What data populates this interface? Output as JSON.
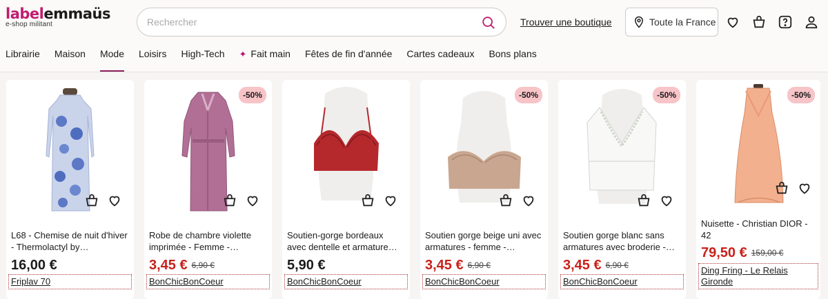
{
  "logo": {
    "part1": "label",
    "part2": "emmaüs",
    "tagline": "e-shop militant"
  },
  "search": {
    "placeholder": "Rechercher"
  },
  "header": {
    "find_store": "Trouver une boutique",
    "location": "Toute la France"
  },
  "nav": [
    "Librairie",
    "Maison",
    "Mode",
    "Loisirs",
    "High-Tech",
    "Fait main",
    "Fêtes de fin d'année",
    "Cartes cadeaux",
    "Bons plans"
  ],
  "nav_active": "Mode",
  "colors": {
    "brand": "#c01d6f",
    "sale_price": "#c8211b",
    "discount_badge": "#f7c4c8",
    "nav_active": "#8b1f5c"
  },
  "products": [
    {
      "title": "L68 - Chemise de nuit d'hiver - Thermolactyl by…",
      "price": "16,00 €",
      "old_price": "",
      "discount": "",
      "seller": "Friplav 70"
    },
    {
      "title": "Robe de chambre violette imprimée - Femme -…",
      "price": "3,45 €",
      "old_price": "6,90 €",
      "discount": "-50%",
      "seller": "BonChicBonCoeur"
    },
    {
      "title": "Soutien-gorge bordeaux avec dentelle et armature…",
      "price": "5,90 €",
      "old_price": "",
      "discount": "",
      "seller": "BonChicBonCoeur"
    },
    {
      "title": "Soutien gorge beige uni avec armatures - femme -…",
      "price": "3,45 €",
      "old_price": "6,90 €",
      "discount": "-50%",
      "seller": "BonChicBonCoeur"
    },
    {
      "title": "Soutien gorge blanc sans armatures avec broderie -…",
      "price": "3,45 €",
      "old_price": "6,90 €",
      "discount": "-50%",
      "seller": "BonChicBonCoeur"
    },
    {
      "title": "Nuisette - Christian DIOR - 42",
      "price": "79,50 €",
      "old_price": "159,00 €",
      "discount": "-50%",
      "seller": "Ding Fring - Le Relais Gironde"
    }
  ]
}
